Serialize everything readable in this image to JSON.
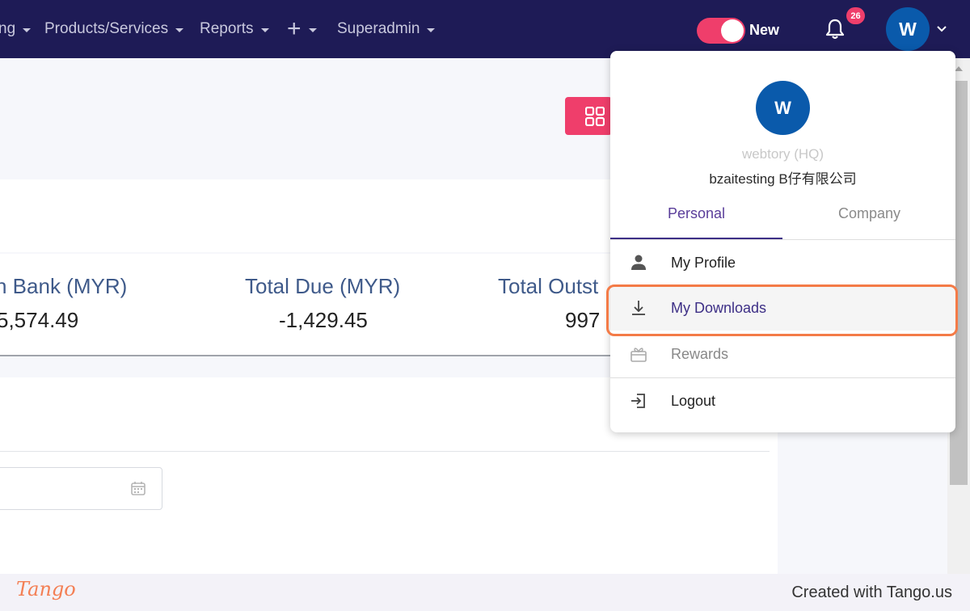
{
  "topnav": {
    "items": [
      {
        "label": "ng"
      },
      {
        "label": "Products/Services"
      },
      {
        "label": "Reports"
      },
      {
        "label": "+"
      },
      {
        "label": "Superadmin"
      }
    ],
    "toggle_label": "New",
    "notification_count": "26",
    "avatar_initial": "W"
  },
  "colors": {
    "nav_bg": "#1e1b56",
    "accent_pink": "#ef3e6b",
    "avatar_blue": "#0a5aab",
    "highlight_orange": "#f47b47"
  },
  "stats": [
    {
      "label": "n Bank (MYR)",
      "value": "5,574.49"
    },
    {
      "label": "Total Due (MYR)",
      "value": "-1,429.45"
    },
    {
      "label": "Total Outst",
      "value": "997"
    }
  ],
  "dropdown": {
    "avatar_initial": "W",
    "company_name": "webtory (HQ)",
    "org_name": "bzaitesting B仔有限公司",
    "tabs": [
      {
        "label": "Personal",
        "active": true
      },
      {
        "label": "Company",
        "active": false
      }
    ],
    "items": [
      {
        "label": "My Profile",
        "icon": "person-icon"
      },
      {
        "label": "My Downloads",
        "icon": "download-icon"
      },
      {
        "label": "Rewards",
        "icon": "gift-icon"
      },
      {
        "label": "Logout",
        "icon": "logout-icon"
      }
    ]
  },
  "footer": {
    "logo": "Tango",
    "credit": "Created with Tango.us"
  }
}
